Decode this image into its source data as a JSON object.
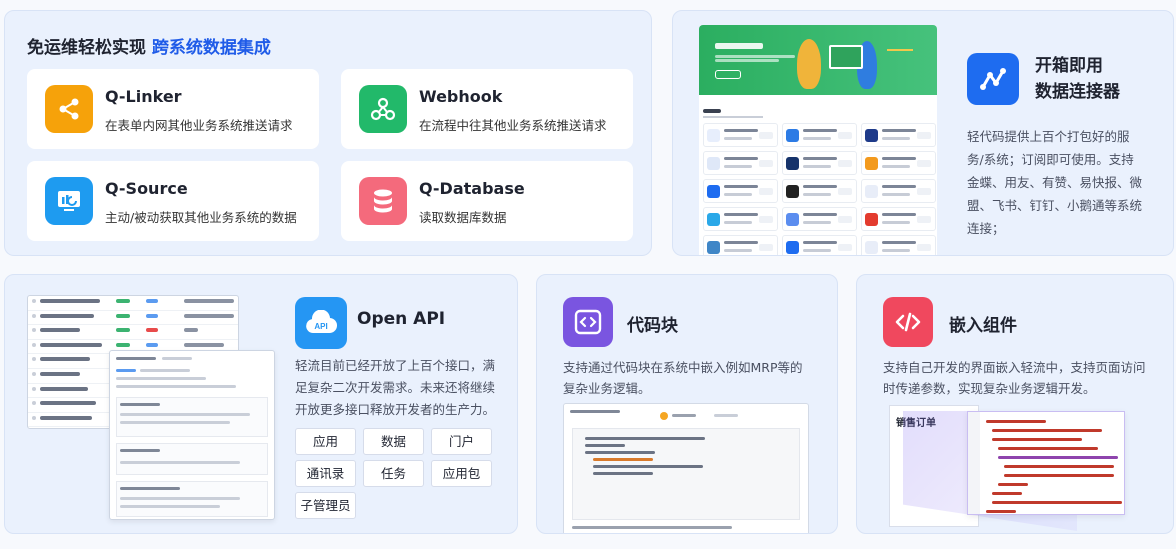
{
  "card1": {
    "title_prefix": "免运维轻松实现",
    "title_highlight": "跨系统数据集成",
    "items": [
      {
        "name": "Q-Linker",
        "desc": "在表单内网其他业务系统推送请求",
        "color": "#f6a20a",
        "icon": "share-icon"
      },
      {
        "name": "Webhook",
        "desc": "在流程中往其他业务系统推送请求",
        "color": "#22b96a",
        "icon": "webhook-icon"
      },
      {
        "name": "Q-Source",
        "desc": "主动/被动获取其他业务系统的数据",
        "color": "#1e9bf0",
        "icon": "monitor-icon"
      },
      {
        "name": "Q-Database",
        "desc": "读取数据库数据",
        "color": "#f46a7c",
        "icon": "database-icon"
      }
    ]
  },
  "card2": {
    "title_line1": "开箱即用",
    "title_line2": "数据连接器",
    "desc": "轻代码提供上百个打包好的服务/系统；订阅即可使用。支持金蝶、用友、有赞、易快报、微盟、飞书、钉钉、小鹅通等系统连接；",
    "color": "#1e6cf0",
    "icon": "connector-icon"
  },
  "card3": {
    "title": "Open API",
    "desc": "轻流目前已经开放了上百个接口，满足复杂二次开发需求。未来还将继续开放更多接口释放开发者的生产力。",
    "tags": [
      "应用",
      "数据",
      "门户",
      "通讯录",
      "任务",
      "应用包",
      "子管理员"
    ],
    "color": "#2596f3",
    "icon": "api-cloud-icon"
  },
  "card4": {
    "title": "代码块",
    "desc": "支持通过代码块在系统中嵌入例如MRP等的复杂业务逻辑。",
    "color": "#7a55e0",
    "icon": "code-icon"
  },
  "card5": {
    "title": "嵌入组件",
    "desc": "支持自己开发的界面嵌入轻流中，支持页面访问时传递参数，实现复杂业务逻辑开发。",
    "mock_title": "销售订单",
    "color": "#f0485e",
    "icon": "code-icon"
  }
}
